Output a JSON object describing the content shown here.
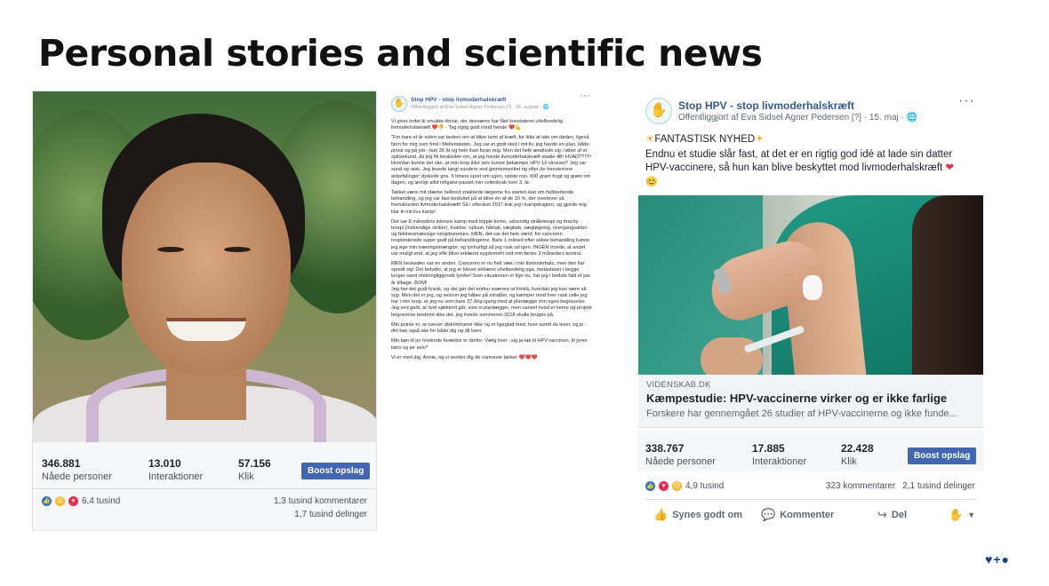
{
  "slide": {
    "title": "Personal stories and scientific news"
  },
  "left_post": {
    "stats": [
      {
        "value": "346.881",
        "label": "Nåede personer"
      },
      {
        "value": "13.010",
        "label": "Interaktioner"
      },
      {
        "value": "57.156",
        "label": "Klik"
      }
    ],
    "boost_label": "Boost opslag",
    "reactions_count": "6,4 tusind",
    "comments": "1,3 tusind kommentarer",
    "shares": "1,7 tusind delinger"
  },
  "middle_post": {
    "page_name": "Stop HPV - stop livmoderhalskræft",
    "byline": "Offentliggjort af Eva Sidsel Agner Pedersen [?] · 20. august · 🌐",
    "paragraphs": [
      "Vi giver ordet til smukke Annie, der desværre har fået konstateret uhelbredelig livmoderhalskræft ❤️👎 · Tag rigtig godt imod hende ❤️💪",
      "\"For bare et år siden var tanken om at blive ramt af kræft, for ikke at tale om døden, ligeså fjern for mig som fred i Mellemøsten. Jeg var et godt sted i mit liv, jeg havde en plan, både privat og på job - kun 36 år og hele livet foran mig. Men det hele ændrede sig i løbet af et splitsekund, da jeg fik beskeden om, at jeg havde livmoderhalskræft stadie 4B! HVAD???!!! Hvordan kunne det ske, at min krop ikke selv kunne bekæmpe HPV 16 virusset? Jeg var sund og rask. Jeg levede langt sundere end gennemsnittet og efter de foreskrevne anbefalinger; dyrkede gns. 9 timers sport om ugen, spiste min. 600 gram frugt og grønt om dagen, og iøvrigt altid religiøst passet min celleskrab hver 3. år.",
      "Takket være mit stærke helbred snakkede lægerne fra starten kun om helbredende behandling, og jeg var fast besluttet på at blive én af de 10 %, der overlever så fremskreden livmoderhalskræft! Så i efteråret 2017 trak jeg i kampdragten, og gjorde mig klar til mit livs kamp!",
      "Det var 8 måneders intensiv kamp med tripple kemo, udvendig stråleterapi og brachy terapi (indvendige stråler), kvalme, opkast, hårtab, vægttab, vægtøgning, overgangsalder og følelsesmæssige rutsjebaneture. MEN, det var det hele værd, for canceren responderede super godt på behandlingerne. Bare 1 måned efter sidste behandling kunne jeg øge min træningsmængde, og lynhurtigt så jeg rask ud igen. INGEN troede, at andet var muligt end, at jeg ville blive erklæret sygdomsfri ved min første 3 måneders kontrol.",
      "MEN beskeden var en anden. Canceren er nu helt væk i min livmoderhals, men den har spredt sig! Det betyder, at jeg er blevet erklæret uhelbredelig pga. metastaser i begge lunger samt omkringliggende lymfer! Som situationen er lige nu, har jeg i bedste fald et par år tilbage. BOM!\nJeg har det godt fysisk, og det gør det endnu sværere at forstå, hvordan jeg kan være så syg. Men det er jeg, og selvom jeg håber på mirakler, og kæmper med hver rask celle jeg har i min krop, er jeg nu som bare 37-årig igang med at planlægge min egen begravelse. Jeg ved godt, at livet sjældent går, som vi planlægger, men uanset hvad er kemo og projekt begravelse bestemt ikke det, jeg troede sommeren 2018 skulle bruges på.",
      "Min pointe er, at cancer diskriminerer ikke og er ligeglad med, hvor sundt du lever, og jo - det kan også ske for både dig og dit barn.",
      "Min bøn til jer tvivlende forældre er derfor: Vælg livet - sig ja-tak til HPV-vaccinen, til jeres børn og jer selv!\"",
      "Vi er med dig, Annie, og vi sender dig de varmeste tanker ❤️❤️❤️"
    ]
  },
  "right_post": {
    "page_name": "Stop HPV - stop livmoderhalskræft",
    "byline": "Offentliggjort af Eva Sidsel Agner Pedersen [?] · 15. maj · 🌐",
    "headline": "FANTASTISK NYHED",
    "text": "Endnu et studie slår fast, at det er en rigtig god idé at lade sin datter HPV-vaccinere, så hun kan blive beskyttet mod livmoderhalskræft",
    "link": {
      "domain": "VIDENSKAB.DK",
      "title": "Kæmpestudie: HPV-vaccinerne virker og er ikke farlige",
      "description": "Forskere har gennemgået 26 studier af HPV-vaccinerne og ikke funde..."
    },
    "stats": [
      {
        "value": "338.767",
        "label": "Nåede personer"
      },
      {
        "value": "17.885",
        "label": "Interaktioner"
      },
      {
        "value": "22.428",
        "label": "Klik"
      }
    ],
    "boost_label": "Boost opslag",
    "reactions_count": "4,9 tusind",
    "comments": "323 kommentarer",
    "shares": "2,1 tusind delinger",
    "actions": {
      "like": "Synes godt om",
      "comment": "Kommenter",
      "share": "Del"
    }
  },
  "footer": {
    "logo": "♥+●"
  }
}
